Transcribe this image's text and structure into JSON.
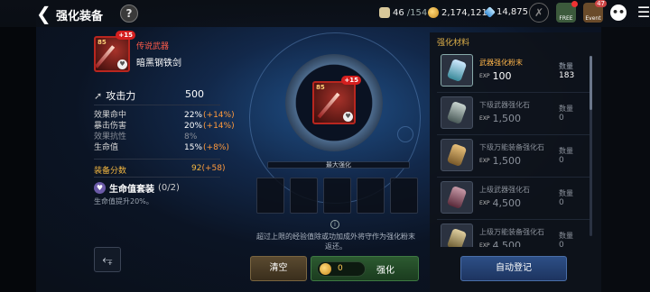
{
  "header": {
    "title": "强化装备",
    "help": "?",
    "stamina": {
      "current": "46",
      "max": "/154"
    },
    "gold": "2,174,121",
    "gems": "14,875",
    "free_label": "FREE",
    "event_label": "Event",
    "event_badge": "47"
  },
  "item": {
    "level": "85",
    "enhance": "+15",
    "grade": "传说武器",
    "name": "暗黑钢铁剑",
    "attack_label": "攻击力",
    "attack_value": "500",
    "stats": [
      {
        "name": "效果命中",
        "value": "22%",
        "bonus": "(+14%)"
      },
      {
        "name": "暴击伤害",
        "value": "20%",
        "bonus": "(+14%)"
      },
      {
        "name": "效果抗性",
        "value": "8%",
        "bonus": ""
      },
      {
        "name": "生命值",
        "value": "15%",
        "bonus": "(+8%)"
      }
    ],
    "score_label": "装备分数",
    "score_value": "92",
    "score_bonus": "(+58)",
    "set_name": "生命值套装",
    "set_count": "(0/2)",
    "set_desc": "生命值提升20%。"
  },
  "center": {
    "max_label": "最大强化",
    "hint": "超过上限的经验值除或功加成外将守作为强化粉末返还。",
    "clear_label": "清空",
    "cost": "0",
    "enhance_label": "强化"
  },
  "materials": {
    "title": "强化材料",
    "qty_label": "数量",
    "items": [
      {
        "name": "武器强化粉末",
        "exp": "100",
        "qty": "183"
      },
      {
        "name": "下级武器强化石",
        "exp": "1,500",
        "qty": "0"
      },
      {
        "name": "下级万能装备强化石",
        "exp": "1,500",
        "qty": "0"
      },
      {
        "name": "上级武器强化石",
        "exp": "4,500",
        "qty": "0"
      },
      {
        "name": "上级万能装备强化石",
        "exp": "4,500",
        "qty": "0"
      }
    ],
    "auto_label": "自动登记"
  }
}
